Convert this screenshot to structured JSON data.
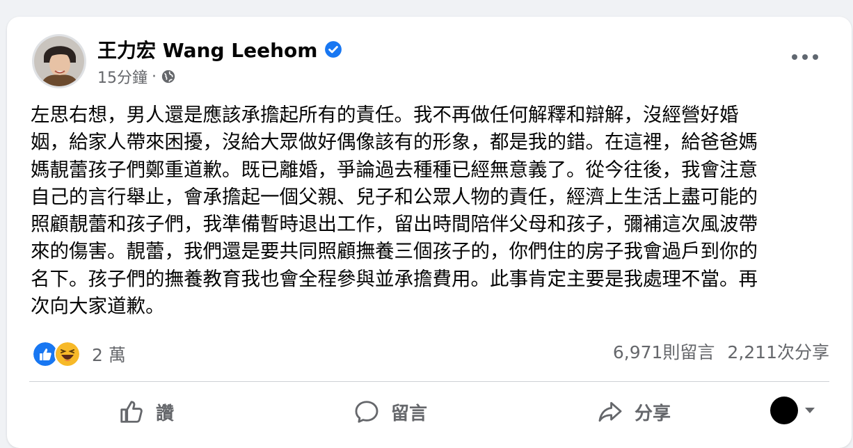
{
  "post": {
    "author": "王力宏 Wang Leehom",
    "verified": true,
    "time": "15分鐘",
    "separator": "·",
    "audience_icon": "globe-icon",
    "body": "左思右想，男人還是應該承擔起所有的責任。我不再做任何解釋和辯解，沒經營好婚\n姻，給家人帶來困擾，沒給大眾做好偶像該有的形象，都是我的錯。在這裡，給爸爸媽\n媽靚蕾孩子們鄭重道歉。既已離婚，爭論過去種種已經無意義了。從今往後，我會注意\n自己的言行舉止，會承擔起一個父親、兒子和公眾人物的責任，經濟上生活上盡可能的\n照顧靚蕾和孩子們，我準備暫時退出工作，留出時間陪伴父母和孩子，彌補這次風波帶\n來的傷害。靚蕾，我們還是要共同照顧撫養三個孩子的，你們住的房子我會過戶到你的\n名下。孩子們的撫養教育我也會全程參與並承擔費用。此事肯定主要是我處理不當。再\n次向大家道歉。"
  },
  "reactions": {
    "icons": [
      "like-icon",
      "haha-icon"
    ],
    "count": "2 萬"
  },
  "stats": {
    "comments": "6,971則留言",
    "shares": "2,211次分享"
  },
  "actions": {
    "like": "讚",
    "comment": "留言",
    "share": "分享"
  },
  "colors": {
    "brand_blue": "#1877f2",
    "haha_yellow": "#f7b928",
    "secondary_text": "#65676b"
  }
}
